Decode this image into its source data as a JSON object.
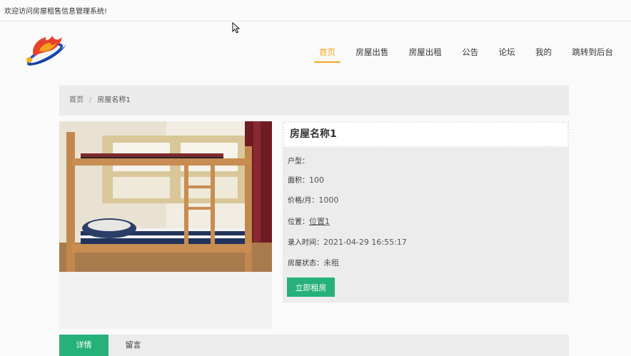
{
  "topbar": {
    "welcome": "欢迎访问房屋租售信息管理系统!"
  },
  "nav": {
    "items": [
      {
        "label": "首页",
        "active": true
      },
      {
        "label": "房屋出售",
        "active": false
      },
      {
        "label": "房屋出租",
        "active": false
      },
      {
        "label": "公告",
        "active": false
      },
      {
        "label": "论坛",
        "active": false
      },
      {
        "label": "我的",
        "active": false
      },
      {
        "label": "跳转到后台",
        "active": false
      }
    ]
  },
  "breadcrumb": {
    "home": "首页",
    "separator": "/",
    "current": "房屋名称1"
  },
  "detail": {
    "title": "房屋名称1",
    "fields": [
      {
        "key": "户型：",
        "value": ""
      },
      {
        "key": "面积：",
        "value": "100"
      },
      {
        "key": "价格/月：",
        "value": "1000"
      },
      {
        "key": "位置：",
        "value": "位置1"
      },
      {
        "key": "录入时间：",
        "value": "2021-04-29 16:55:17"
      },
      {
        "key": "房屋状态：",
        "value": "未租"
      }
    ],
    "rent_button": "立即租房"
  },
  "tabs": [
    {
      "label": "详情",
      "active": true
    },
    {
      "label": "留言",
      "active": false
    }
  ],
  "colors": {
    "accent": "#f5a623",
    "primary": "#26b07a"
  }
}
